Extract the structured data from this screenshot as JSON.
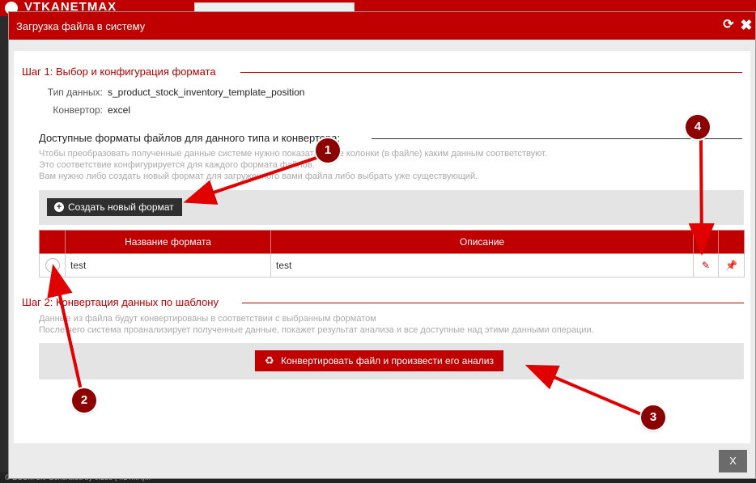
{
  "background": {
    "brand_text": "VTKANETMAX",
    "footer_text": "© ECOM 3.0 Generated by 0.235 (4.14MA)..."
  },
  "modal": {
    "title": "Загрузка файла в систему",
    "close_label": "X"
  },
  "step1": {
    "title": "Шаг 1: Выбор и конфигурация формата",
    "data_type_label": "Тип данных:",
    "data_type_value": "s_product_stock_inventory_template_position",
    "converter_label": "Конвертор:",
    "converter_value": "excel",
    "formats_title": "Доступные форматы файлов для данного типа и конвертора:",
    "hint_lines": [
      "Чтобы преобразовать полученные данные системе нужно показать какие колонки (в файле) каким данным соответствуют.",
      "Это соответствие конфигурируется для каждого формата файлов.",
      "Вам нужно либо создать новый формат для загруженного вами файла либо выбрать уже существующий."
    ],
    "create_button": "Создать новый формат",
    "table": {
      "headers": [
        "",
        "Название формата",
        "Описание",
        "",
        ""
      ],
      "rows": [
        {
          "name": "test",
          "description": "test"
        }
      ]
    }
  },
  "step2": {
    "title": "Шаг 2: Конвертация данных по шаблону",
    "hint_lines": [
      "Данные из файла будут конвертированы в соответствии с выбранным форматом",
      "После чего система проанализирует полученные данные, покажет результат анализа и все доступные над этими данными операции."
    ],
    "convert_button": "Конвертировать файл и произвести его анализ"
  },
  "callouts": [
    "1",
    "2",
    "3",
    "4"
  ],
  "colors": {
    "accent": "#c00000",
    "callout": "#8b0000",
    "arrow": "#e00000"
  }
}
